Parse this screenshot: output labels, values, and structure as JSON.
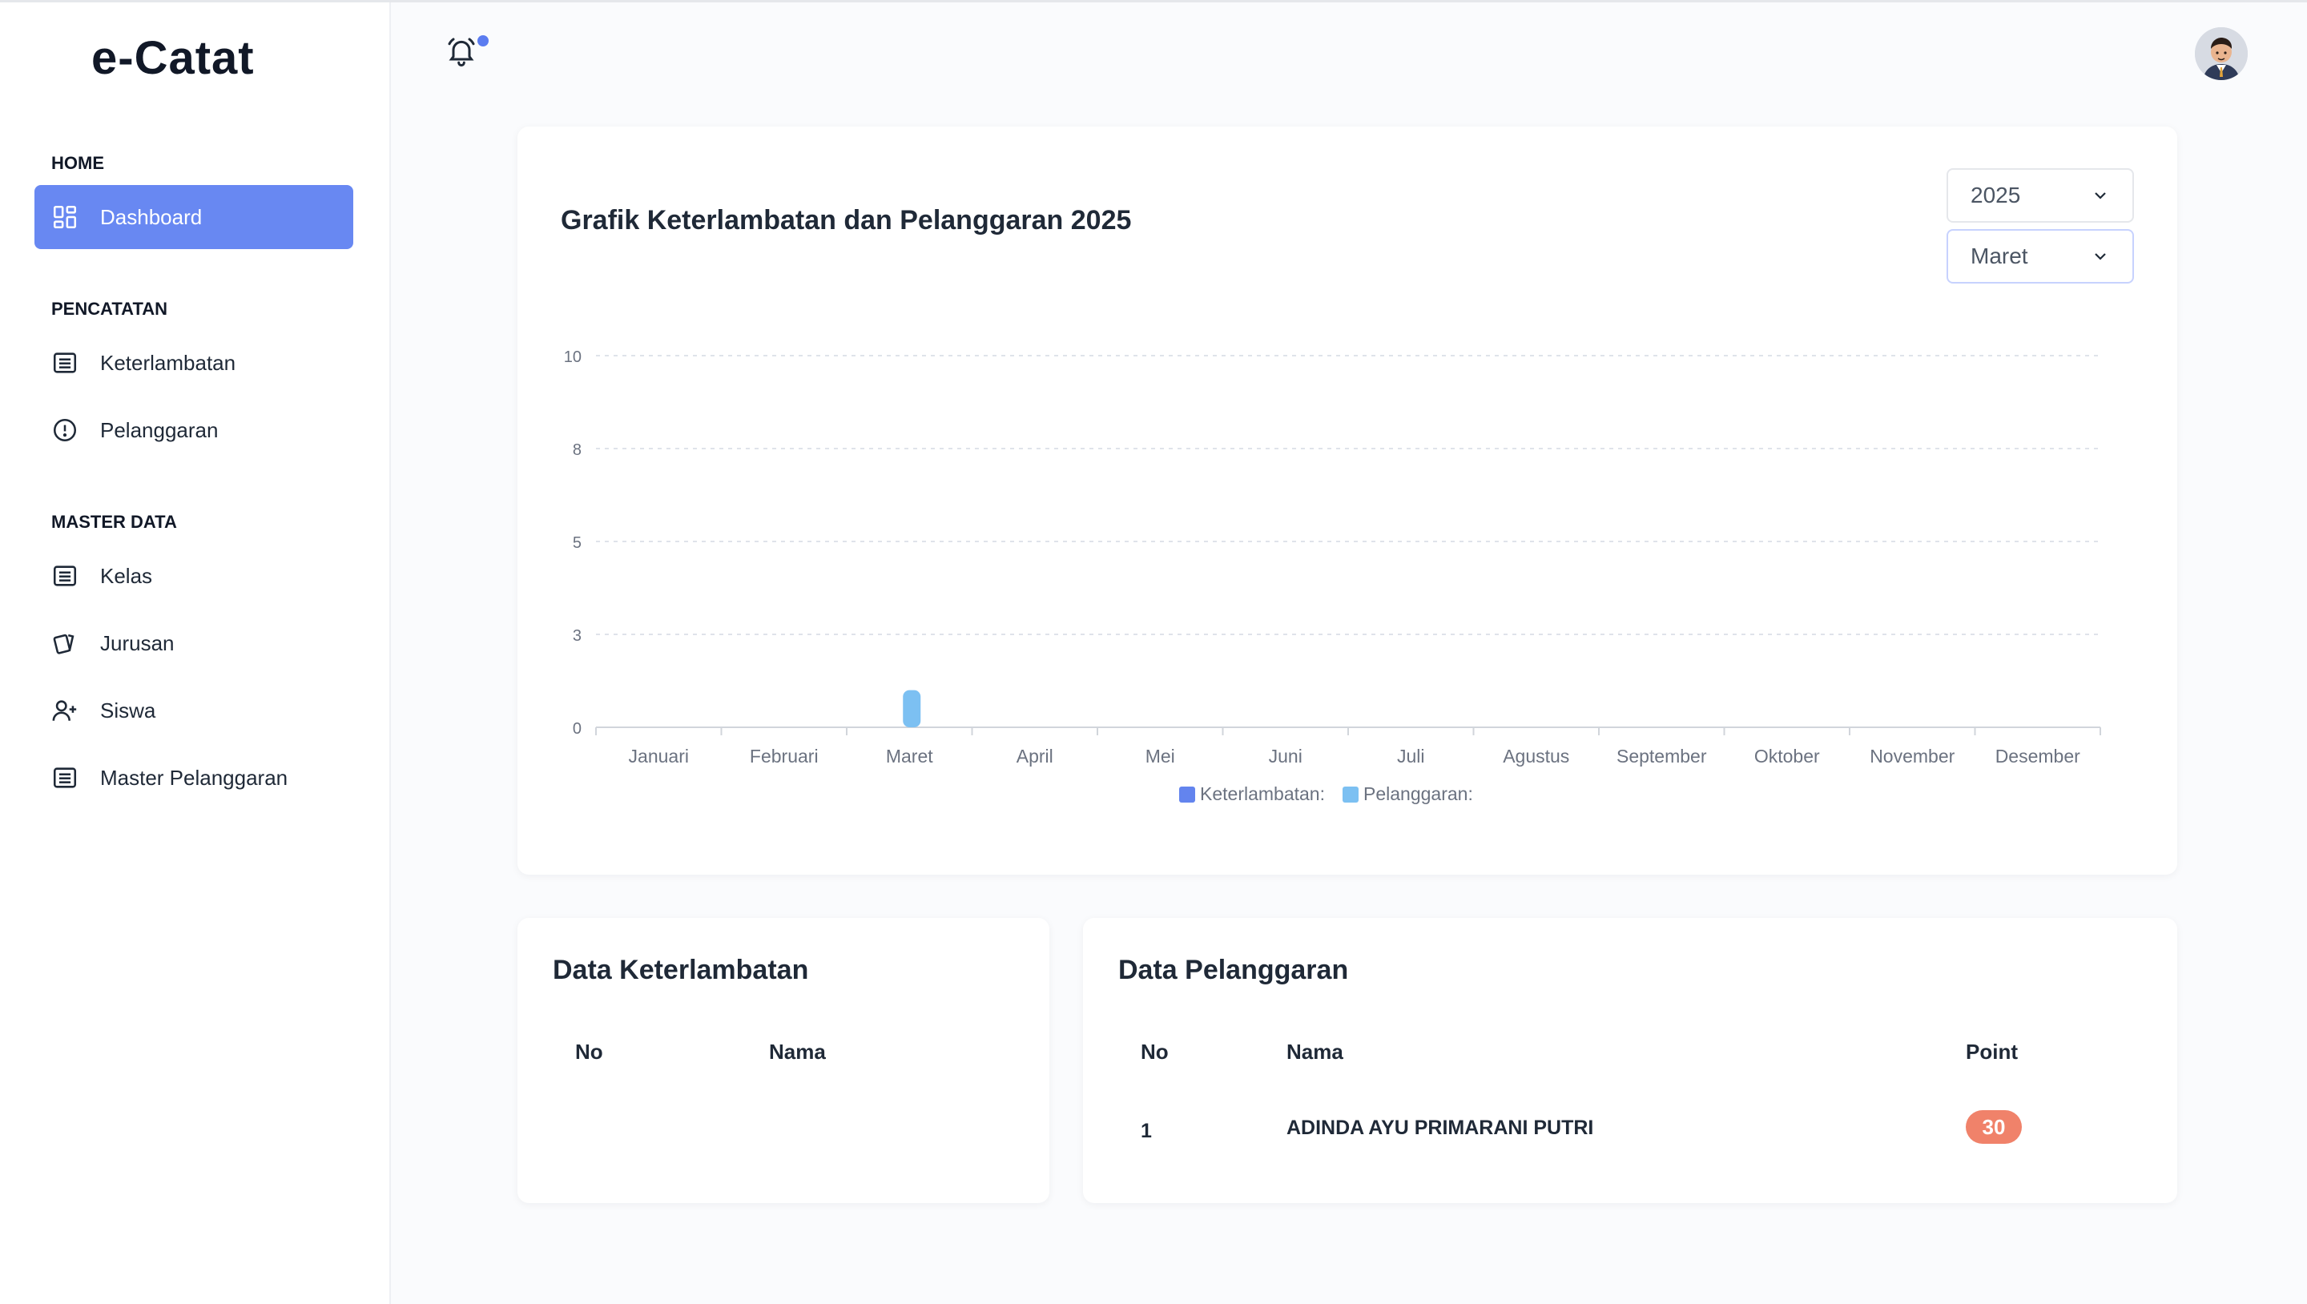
{
  "app": {
    "logo": "e-Catat"
  },
  "sidebar": {
    "sections": [
      {
        "label": "HOME"
      },
      {
        "label": "PENCATATAN"
      },
      {
        "label": "MASTER DATA"
      }
    ],
    "items": [
      {
        "label": "Dashboard",
        "icon": "dashboard-icon",
        "active": true
      },
      {
        "label": "Keterlambatan",
        "icon": "list-icon"
      },
      {
        "label": "Pelanggaran",
        "icon": "alert-circle-icon"
      },
      {
        "label": "Kelas",
        "icon": "list-icon"
      },
      {
        "label": "Jurusan",
        "icon": "cards-icon"
      },
      {
        "label": "Siswa",
        "icon": "user-plus-icon"
      },
      {
        "label": "Master Pelanggaran",
        "icon": "list-icon"
      }
    ]
  },
  "header": {
    "notification_icon": "bell-icon",
    "has_notification": true
  },
  "filters": {
    "year": "2025",
    "month": "Maret"
  },
  "chart_data": {
    "type": "bar",
    "title": "Grafik Keterlambatan dan Pelanggaran 2025",
    "categories": [
      "Januari",
      "Februari",
      "Maret",
      "April",
      "Mei",
      "Juni",
      "Juli",
      "Agustus",
      "September",
      "Oktober",
      "November",
      "Desember"
    ],
    "series": [
      {
        "name": "Keterlambatan:",
        "color": "#6384ee",
        "values": [
          0,
          0,
          0,
          0,
          0,
          0,
          0,
          0,
          0,
          0,
          0,
          0
        ]
      },
      {
        "name": "Pelanggaran:",
        "color": "#7cc0f2",
        "values": [
          0,
          0,
          1,
          0,
          0,
          0,
          0,
          0,
          0,
          0,
          0,
          0
        ]
      }
    ],
    "yticks": [
      "0",
      "3",
      "5",
      "8",
      "10"
    ],
    "ylim": [
      0,
      10
    ],
    "grid": true,
    "legend": "bottom"
  },
  "tables": {
    "keterlambatan": {
      "title": "Data Keterlambatan",
      "headers": [
        "No",
        "Nama"
      ],
      "rows": []
    },
    "pelanggaran": {
      "title": "Data Pelanggaran",
      "headers": [
        "No",
        "Nama",
        "Point"
      ],
      "rows": [
        {
          "no": "1",
          "nama": "ADINDA AYU PRIMARANI PUTRI",
          "point": "30"
        }
      ],
      "badge_color": "#f0826a"
    }
  },
  "colors": {
    "accent": "#6888f2"
  }
}
